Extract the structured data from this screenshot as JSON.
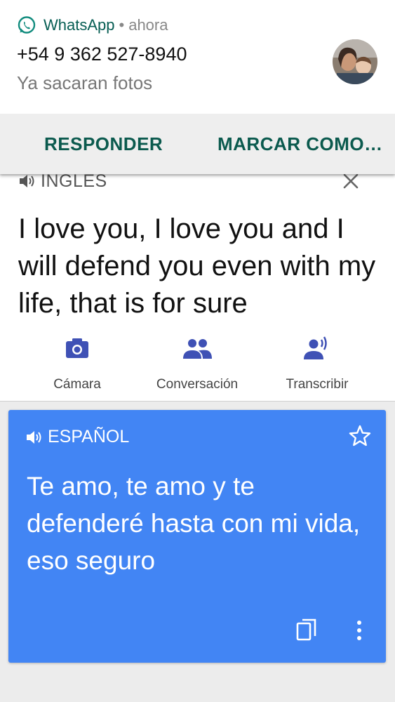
{
  "notification": {
    "app_name": "WhatsApp",
    "separator": "•",
    "time": "ahora",
    "sender": "+54 9 362 527-8940",
    "message": "Ya sacaran fotos",
    "actions": {
      "reply": "RESPONDER",
      "mark_as": "MARCAR COMO…"
    },
    "icons": {
      "app": "whatsapp-icon",
      "avatar": "contact-avatar"
    },
    "brand_color": "#075e54"
  },
  "translate": {
    "source_language": "INGLES",
    "source_text": "I love you, I love you and I will defend you even with my life, that is for sure",
    "tools": [
      {
        "label": "Cámara",
        "icon": "camera-icon"
      },
      {
        "label": "Conversación",
        "icon": "conversation-icon"
      },
      {
        "label": "Transcribir",
        "icon": "transcribe-icon"
      }
    ],
    "result": {
      "language": "ESPAÑOL",
      "text": "Te amo, te amo y te defenderé hasta con mi vida, eso seguro",
      "card_color": "#4285f4"
    },
    "icon_color": "#3f51b5"
  }
}
